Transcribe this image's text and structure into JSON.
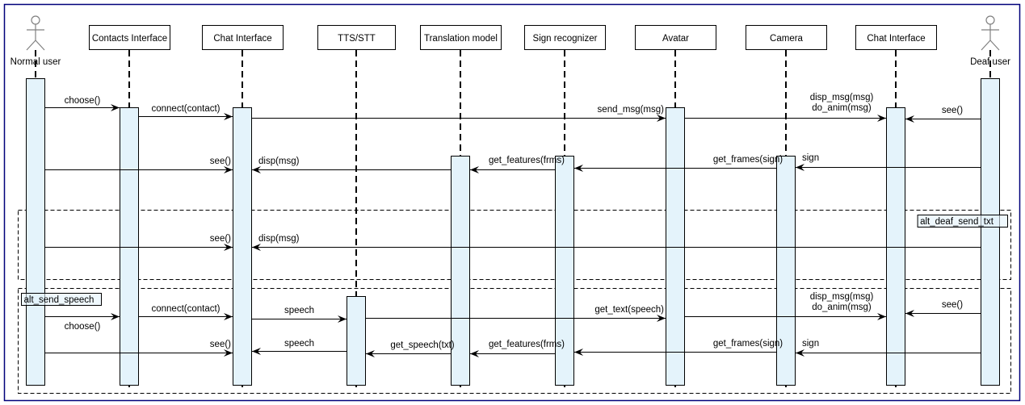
{
  "diagram": {
    "type": "uml-sequence",
    "participants": [
      {
        "id": "normal_user",
        "label": "Normal user",
        "kind": "actor"
      },
      {
        "id": "contacts_interface",
        "label": "Contacts Interface",
        "kind": "object"
      },
      {
        "id": "chat_interface_1",
        "label": "Chat Interface",
        "kind": "object"
      },
      {
        "id": "tts_stt",
        "label": "TTS/STT",
        "kind": "object"
      },
      {
        "id": "translation_model",
        "label": "Translation model",
        "kind": "object"
      },
      {
        "id": "sign_recognizer",
        "label": "Sign recognizer",
        "kind": "object"
      },
      {
        "id": "avatar",
        "label": "Avatar",
        "kind": "object"
      },
      {
        "id": "camera",
        "label": "Camera",
        "kind": "object"
      },
      {
        "id": "chat_interface_2",
        "label": "Chat Interface",
        "kind": "object"
      },
      {
        "id": "deaf_user",
        "label": "Deaf user",
        "kind": "actor"
      }
    ],
    "fragments": [
      {
        "label": "alt_deaf_send_txt",
        "label_position": "top-right"
      },
      {
        "label": "alt_send_speech",
        "label_position": "top-left"
      }
    ],
    "messages": [
      {
        "from": "normal_user",
        "to": "contacts_interface",
        "label": "choose()",
        "section": "main"
      },
      {
        "from": "contacts_interface",
        "to": "chat_interface_1",
        "label": "connect(contact)",
        "section": "main"
      },
      {
        "from": "chat_interface_1",
        "to": "avatar",
        "label": "send_msg(msg)",
        "section": "main"
      },
      {
        "from": "avatar",
        "to": "chat_interface_2",
        "label": "disp_msg(msg)\ndo_anim(msg)",
        "section": "main"
      },
      {
        "from": "deaf_user",
        "to": "chat_interface_2",
        "label": "see()",
        "section": "main"
      },
      {
        "from": "deaf_user",
        "to": "camera",
        "label": "sign",
        "section": "main"
      },
      {
        "from": "camera",
        "to": "sign_recognizer",
        "label": "get_frames(sign)",
        "section": "main"
      },
      {
        "from": "sign_recognizer",
        "to": "translation_model",
        "label": "get_features(frms)",
        "section": "main"
      },
      {
        "from": "translation_model",
        "to": "chat_interface_1",
        "label": "disp(msg)",
        "section": "main"
      },
      {
        "from": "normal_user",
        "to": "chat_interface_1",
        "label": "see()",
        "section": "main"
      },
      {
        "from": "deaf_user",
        "to": "chat_interface_1",
        "label": "disp(msg)",
        "section": "alt_deaf_send_txt"
      },
      {
        "from": "normal_user",
        "to": "chat_interface_1",
        "label": "see()",
        "section": "alt_deaf_send_txt"
      },
      {
        "from": "normal_user",
        "to": "contacts_interface",
        "label": "choose()",
        "section": "alt_send_speech"
      },
      {
        "from": "contacts_interface",
        "to": "chat_interface_1",
        "label": "connect(contact)",
        "section": "alt_send_speech"
      },
      {
        "from": "chat_interface_1",
        "to": "tts_stt",
        "label": "speech",
        "section": "alt_send_speech"
      },
      {
        "from": "tts_stt",
        "to": "avatar",
        "label": "get_text(speech)",
        "section": "alt_send_speech"
      },
      {
        "from": "avatar",
        "to": "chat_interface_2",
        "label": "disp_msg(msg)\ndo_anim(msg)",
        "section": "alt_send_speech"
      },
      {
        "from": "deaf_user",
        "to": "chat_interface_2",
        "label": "see()",
        "section": "alt_send_speech"
      },
      {
        "from": "deaf_user",
        "to": "camera",
        "label": "sign",
        "section": "alt_send_speech"
      },
      {
        "from": "camera",
        "to": "sign_recognizer",
        "label": "get_frames(sign)",
        "section": "alt_send_speech"
      },
      {
        "from": "sign_recognizer",
        "to": "translation_model",
        "label": "get_features(frms)",
        "section": "alt_send_speech"
      },
      {
        "from": "translation_model",
        "to": "tts_stt",
        "label": "get_speech(txt)",
        "section": "alt_send_speech"
      },
      {
        "from": "tts_stt",
        "to": "chat_interface_1",
        "label": "speech",
        "section": "alt_send_speech"
      },
      {
        "from": "normal_user",
        "to": "chat_interface_1",
        "label": "see()",
        "section": "alt_send_speech"
      }
    ]
  }
}
